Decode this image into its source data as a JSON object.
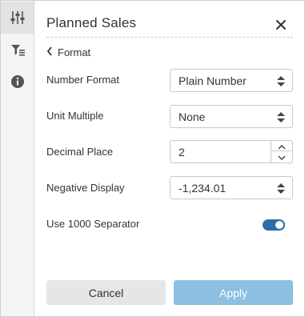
{
  "rail": {
    "items": [
      {
        "icon": "sliders-icon",
        "active": true
      },
      {
        "icon": "filter-list-icon",
        "active": false
      },
      {
        "icon": "info-icon",
        "active": false
      }
    ]
  },
  "panel": {
    "title": "Planned Sales",
    "back_label": "Format"
  },
  "form": {
    "number_format": {
      "label": "Number Format",
      "value": "Plain Number"
    },
    "unit_multiple": {
      "label": "Unit Multiple",
      "value": "None"
    },
    "decimal_place": {
      "label": "Decimal Place",
      "value": "2"
    },
    "negative_display": {
      "label": "Negative Display",
      "value": "-1,234.01"
    },
    "separator": {
      "label": "Use 1000 Separator",
      "enabled": true
    }
  },
  "actions": {
    "cancel_label": "Cancel",
    "apply_label": "Apply"
  },
  "colors": {
    "accent": "#2c6ea6",
    "apply_button": "#8dbfe1",
    "cancel_button": "#e6e6e6"
  }
}
